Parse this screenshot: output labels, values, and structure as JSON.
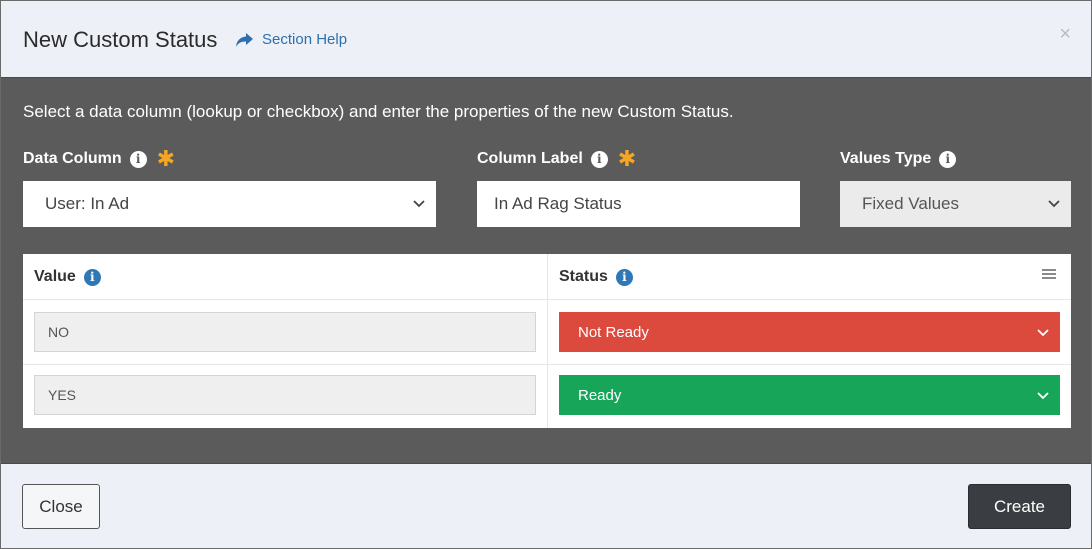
{
  "header": {
    "title": "New Custom Status",
    "help_label": "Section Help",
    "help_icon": "share-arrow-icon",
    "close_glyph": "×"
  },
  "body": {
    "instructions": "Select a data column (lookup or checkbox) and enter the properties of the new Custom Status.",
    "fields": {
      "data_column": {
        "label": "Data Column",
        "value": "User: In Ad",
        "required": true
      },
      "column_label": {
        "label": "Column Label",
        "value": "In Ad Rag Status",
        "required": true
      },
      "values_type": {
        "label": "Values Type",
        "value": "Fixed Values",
        "required": false
      }
    },
    "table": {
      "columns": [
        "Value",
        "Status"
      ],
      "rows": [
        {
          "value": "NO",
          "status": "Not Ready",
          "status_color": "#dc4a3d"
        },
        {
          "value": "YES",
          "status": "Ready",
          "status_color": "#17a55a"
        }
      ]
    },
    "colors": {
      "required_star": "#f5a623",
      "info_blue": "#2f77b5",
      "link_blue": "#2f6fad"
    }
  },
  "footer": {
    "close_label": "Close",
    "create_label": "Create"
  }
}
